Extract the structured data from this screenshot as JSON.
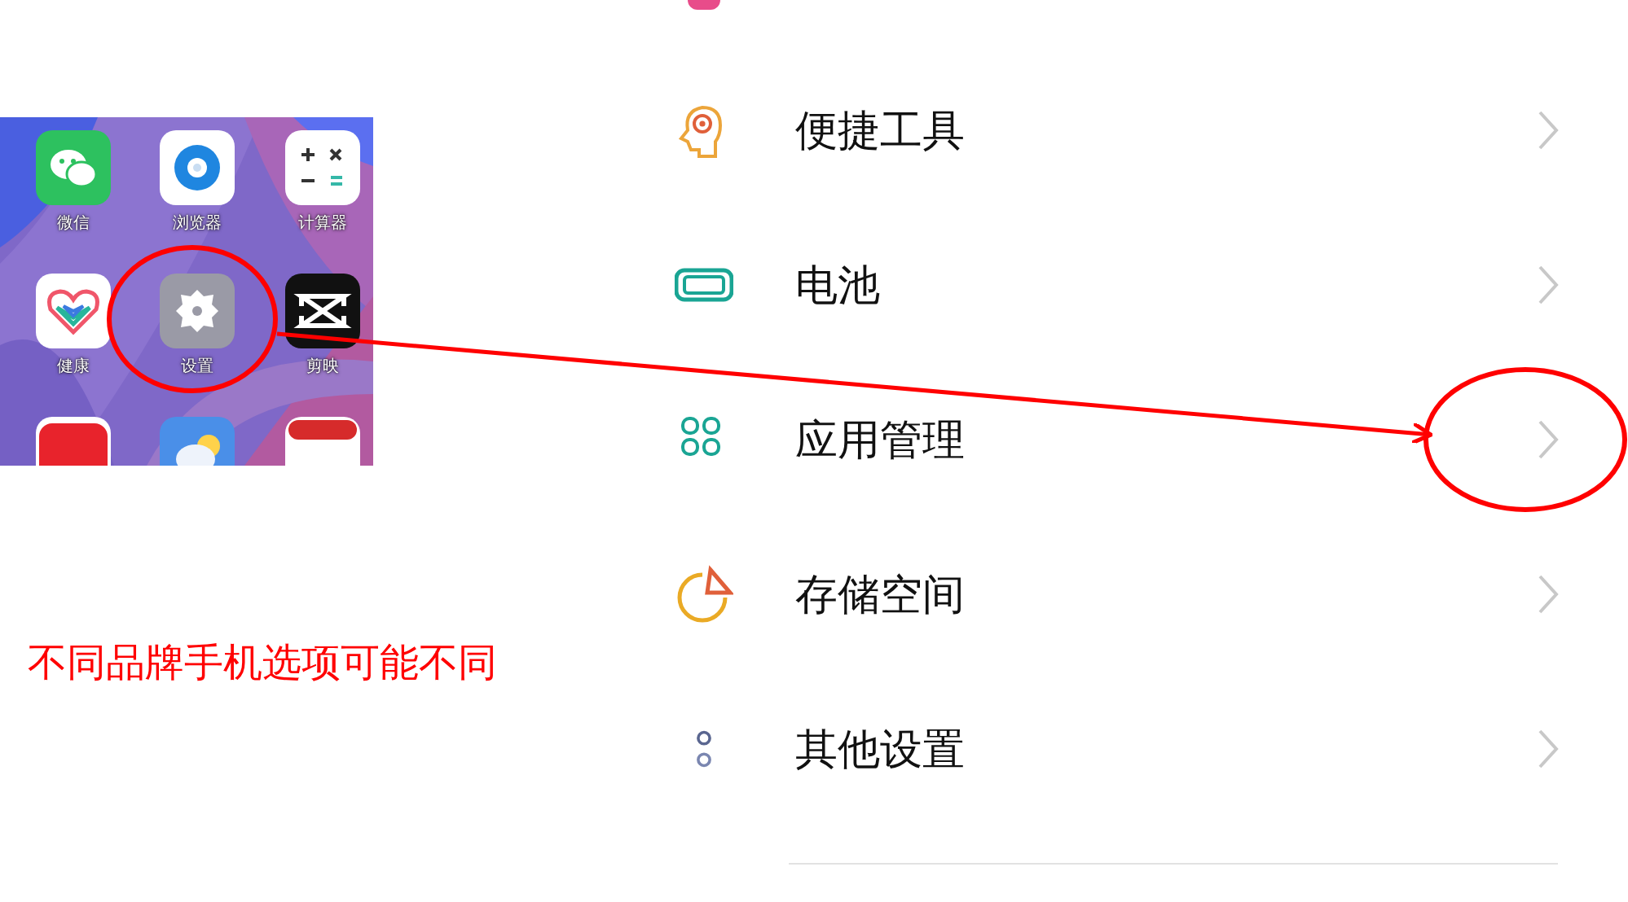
{
  "home_screen": {
    "apps": [
      {
        "label": "微信",
        "kind": "chat"
      },
      {
        "label": "浏览器",
        "kind": "browser"
      },
      {
        "label": "计算器",
        "kind": "calculator"
      },
      {
        "label": "健康",
        "kind": "health"
      },
      {
        "label": "设置",
        "kind": "settings"
      },
      {
        "label": "剪映",
        "kind": "editor"
      },
      {
        "kind": "news"
      },
      {
        "kind": "weather"
      },
      {
        "kind": "calendar"
      }
    ]
  },
  "note": "不同品牌手机选项可能不同",
  "settings_list": {
    "items": [
      {
        "label": "便捷工具",
        "kind": "tools"
      },
      {
        "label": "电池",
        "kind": "battery"
      },
      {
        "label": "应用管理",
        "kind": "apps"
      },
      {
        "label": "存储空间",
        "kind": "storage"
      },
      {
        "label": "其他设置",
        "kind": "other"
      }
    ]
  }
}
